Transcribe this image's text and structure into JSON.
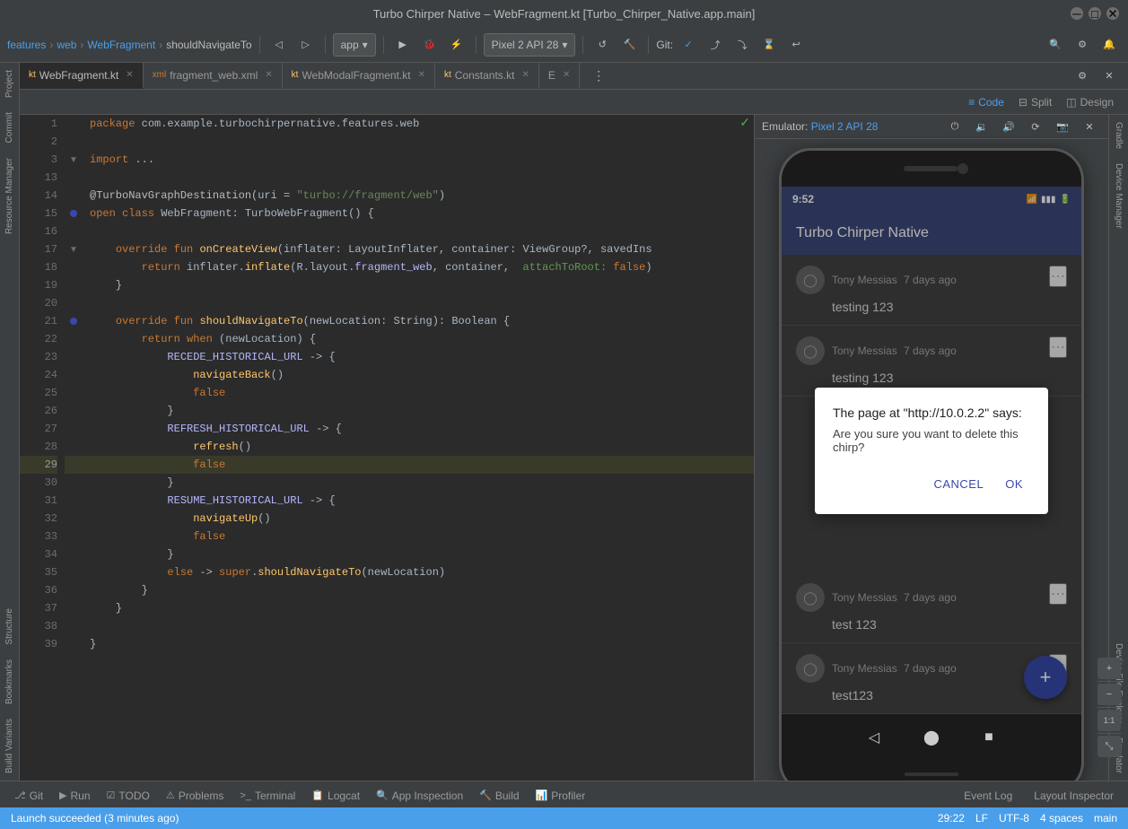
{
  "titleBar": {
    "title": "Turbo Chirper Native – WebFragment.kt [Turbo_Chirper_Native.app.main]"
  },
  "toolbar": {
    "breadcrumb": [
      "features",
      "web",
      "WebFragment",
      "shouldNavigateTo"
    ],
    "appDropdown": "app",
    "deviceDropdown": "Pixel 2 API 28",
    "gitLabel": "Git:"
  },
  "tabs": [
    {
      "label": "WebFragment.kt",
      "icon": "kt",
      "active": true
    },
    {
      "label": "fragment_web.xml",
      "icon": "xml",
      "active": false
    },
    {
      "label": "WebModalFragment.kt",
      "icon": "kt",
      "active": false
    },
    {
      "label": "Constants.kt",
      "icon": "kt",
      "active": false
    },
    {
      "label": "E",
      "icon": "",
      "active": false
    }
  ],
  "viewModes": [
    {
      "label": "Code",
      "active": true
    },
    {
      "label": "Split",
      "active": false
    },
    {
      "label": "Design",
      "active": false
    }
  ],
  "code": {
    "lines": [
      {
        "num": 1,
        "content": "package com.example.turbochirpernative.features.web",
        "type": "package"
      },
      {
        "num": 2,
        "content": "",
        "type": "blank"
      },
      {
        "num": 3,
        "content": "import ...",
        "type": "import"
      },
      {
        "num": 13,
        "content": "",
        "type": "blank"
      },
      {
        "num": 14,
        "content": "@TurboNavGraphDestination(uri = \"turbo://fragment/web\")",
        "type": "annotation"
      },
      {
        "num": 15,
        "content": "open class WebFragment: TurboWebFragment() {",
        "type": "code"
      },
      {
        "num": 16,
        "content": "",
        "type": "blank"
      },
      {
        "num": 17,
        "content": "    override fun onCreateView(inflater: LayoutInflater, container: ViewGroup?, savedIns",
        "type": "code"
      },
      {
        "num": 18,
        "content": "        return inflater.inflate(R.layout.fragment_web, container,  attachToRoot: false)",
        "type": "code"
      },
      {
        "num": 19,
        "content": "    }",
        "type": "code"
      },
      {
        "num": 20,
        "content": "",
        "type": "blank"
      },
      {
        "num": 21,
        "content": "    override fun shouldNavigateTo(newLocation: String): Boolean {",
        "type": "code"
      },
      {
        "num": 22,
        "content": "        return when (newLocation) {",
        "type": "code"
      },
      {
        "num": 23,
        "content": "            RECEDE_HISTORICAL_URL -> {",
        "type": "code"
      },
      {
        "num": 24,
        "content": "                navigateBack()",
        "type": "code"
      },
      {
        "num": 25,
        "content": "                false",
        "type": "code"
      },
      {
        "num": 26,
        "content": "            }",
        "type": "code"
      },
      {
        "num": 27,
        "content": "            REFRESH_HISTORICAL_URL -> {",
        "type": "code"
      },
      {
        "num": 28,
        "content": "                refresh()",
        "type": "code"
      },
      {
        "num": 29,
        "content": "                false",
        "type": "code",
        "highlighted": true
      },
      {
        "num": 30,
        "content": "            }",
        "type": "code"
      },
      {
        "num": 31,
        "content": "            RESUME_HISTORICAL_URL -> {",
        "type": "code"
      },
      {
        "num": 32,
        "content": "                navigateUp()",
        "type": "code"
      },
      {
        "num": 33,
        "content": "                false",
        "type": "code"
      },
      {
        "num": 34,
        "content": "            }",
        "type": "code"
      },
      {
        "num": 35,
        "content": "            else -> super.shouldNavigateTo(newLocation)",
        "type": "code"
      },
      {
        "num": 36,
        "content": "        }",
        "type": "code"
      },
      {
        "num": 37,
        "content": "    }",
        "type": "code"
      },
      {
        "num": 38,
        "content": "",
        "type": "blank"
      },
      {
        "num": 39,
        "content": "}",
        "type": "code"
      }
    ]
  },
  "emulator": {
    "title": "Emulator:",
    "deviceName": "Pixel 2 API 28",
    "phone": {
      "statusBar": {
        "time": "9:52",
        "icons": [
          "wifi",
          "signal",
          "battery"
        ]
      },
      "appBar": {
        "title": "Turbo Chirper Native"
      },
      "chirps": [
        {
          "user": "Tony Messias",
          "time": "7 days ago",
          "text": "testing 123"
        },
        {
          "user": "Tony Messias",
          "time": "7 days ago",
          "text": "testing 123"
        },
        {
          "user": "Tony Messias",
          "time": "7 days ago",
          "text": "test 123"
        },
        {
          "user": "Tony Messias",
          "time": "7 days ago",
          "text": "test123"
        }
      ],
      "dialog": {
        "title": "The page at \"http://10.0.2.2\" says:",
        "message": "Are you sure you want to delete this chirp?",
        "cancelLabel": "CANCEL",
        "okLabel": "OK"
      }
    }
  },
  "bottomTabs": [
    {
      "label": "Git",
      "icon": "⎇",
      "active": false
    },
    {
      "label": "Run",
      "icon": "▶",
      "active": false
    },
    {
      "label": "TODO",
      "icon": "☑",
      "active": false
    },
    {
      "label": "Problems",
      "icon": "⚠",
      "active": false
    },
    {
      "label": "Terminal",
      "icon": ">_",
      "active": false
    },
    {
      "label": "Logcat",
      "icon": "📋",
      "active": false
    },
    {
      "label": "App Inspection",
      "icon": "🔍",
      "active": false
    },
    {
      "label": "Build",
      "icon": "🔨",
      "active": false
    },
    {
      "label": "Profiler",
      "icon": "📊",
      "active": false
    }
  ],
  "bottomRightTabs": [
    {
      "label": "Event Log",
      "active": false
    },
    {
      "label": "Layout Inspector",
      "active": false
    }
  ],
  "statusBar": {
    "message": "Launch succeeded (3 minutes ago)",
    "position": "29:22",
    "encoding": "LF",
    "charset": "UTF-8",
    "indent": "4 spaces",
    "branch": "main"
  },
  "rightPanels": [
    {
      "label": "Project",
      "active": false
    },
    {
      "label": "Commit",
      "active": false
    },
    {
      "label": "Resource Manager",
      "active": false
    },
    {
      "label": "Structure",
      "active": false
    },
    {
      "label": "Bookmarks",
      "active": false
    },
    {
      "label": "Build Variants",
      "active": false
    }
  ],
  "rightPanels2": [
    {
      "label": "Gradle",
      "active": false
    },
    {
      "label": "Device Manager",
      "active": false
    },
    {
      "label": "Device File Explorer",
      "active": false
    },
    {
      "label": "Emulator",
      "active": false
    }
  ]
}
